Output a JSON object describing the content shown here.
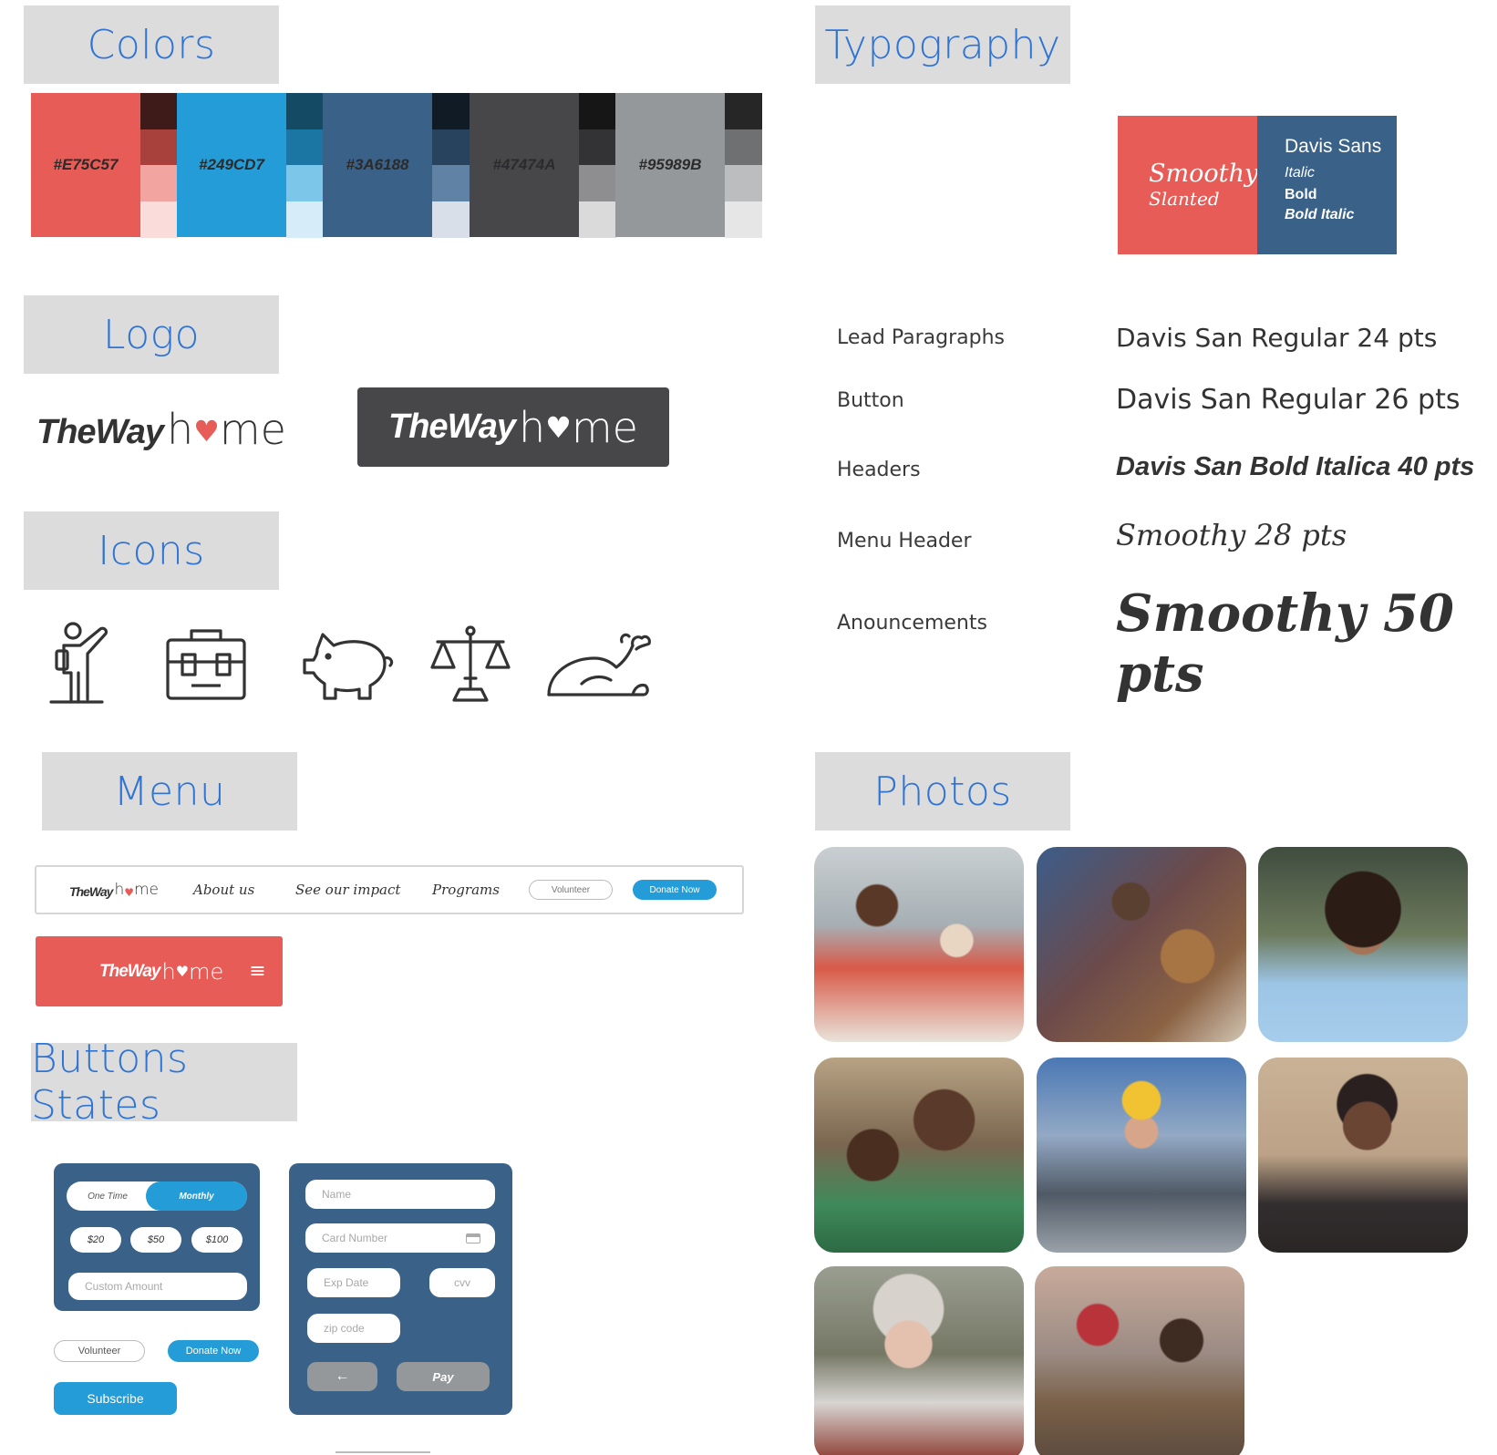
{
  "sections": {
    "colors": "Colors",
    "typography": "Typography",
    "logo": "Logo",
    "icons": "Icons",
    "menu": "Menu",
    "photos": "Photos",
    "buttons": "Buttons States"
  },
  "palette": [
    {
      "label": "#E75C57",
      "main": "#E75C57",
      "shades": [
        "#3e1a19",
        "#a8403c",
        "#f2a4a1",
        "#fadcdb"
      ]
    },
    {
      "label": "#249CD7",
      "main": "#249CD7",
      "shades": [
        "#144a63",
        "#1b76a4",
        "#7cc6ea",
        "#d6ecf8"
      ]
    },
    {
      "label": "#3A6188",
      "main": "#3A6188",
      "shades": [
        "#101b26",
        "#27435e",
        "#5f82a5",
        "#d9dfe8"
      ]
    },
    {
      "label": "#47474A",
      "main": "#47474A",
      "shades": [
        "#161616",
        "#333335",
        "#8e8e90",
        "#dadada"
      ]
    },
    {
      "label": "#95989B",
      "main": "#95989B",
      "shades": [
        "#262626",
        "#6e7072",
        "#bcbdbf",
        "#e6e6e6"
      ]
    }
  ],
  "logo": {
    "the_way": "TheWay",
    "h": "h",
    "me": "me",
    "heart_color": "#E75C57"
  },
  "type_specimen": {
    "smoothy": "Smoothy",
    "slanted": "Slanted",
    "davis": "Davis Sans",
    "italic": "Italic",
    "bold": "Bold",
    "bold_italic": "Bold Italic"
  },
  "type_rows": [
    {
      "label": "Lead Paragraphs",
      "value": "Davis San Regular 24 pts"
    },
    {
      "label": "Button",
      "value": "Davis San Regular 26 pts"
    },
    {
      "label": "Headers",
      "value": "Davis San Bold Italica 40 pts"
    },
    {
      "label": "Menu Header",
      "value": "Smoothy 28 pts"
    },
    {
      "label": "Anouncements",
      "value": "Smoothy 50 pts"
    }
  ],
  "icons": [
    "volunteer-icon",
    "briefcase-icon",
    "piggy-bank-icon",
    "scales-icon",
    "turkey-icon"
  ],
  "menu": {
    "about": "About us",
    "impact": "See our impact",
    "programs": "Programs",
    "volunteer": "Volunteer",
    "donate": "Donate Now"
  },
  "donation_card": {
    "one_time": "One Time",
    "monthly": "Monthly",
    "amounts": [
      "$20",
      "$50",
      "$100"
    ],
    "custom_placeholder": "Custom Amount"
  },
  "standalone_buttons": {
    "volunteer": "Volunteer",
    "donate": "Donate Now",
    "subscribe": "Subscribe"
  },
  "payment_card": {
    "name": "Name",
    "card_number": "Card Number",
    "exp": "Exp Date",
    "cvv": "cvv",
    "zip": "zip code",
    "back": "←",
    "pay": "Pay"
  },
  "photos": [
    "volunteer-with-elderly-woman",
    "mother-and-child-with-teddy",
    "volunteer-woman-smiling",
    "couple-selfie",
    "worker-thumbs-up",
    "smiling-man-in-jacket",
    "elderly-woman-in-beanie",
    "volunteer-helping-man"
  ],
  "colors": {
    "accent": "#2f74d4",
    "brand_red": "#E75C57",
    "brand_blue": "#249CD7",
    "navy": "#3A6188",
    "charcoal": "#47474A"
  }
}
